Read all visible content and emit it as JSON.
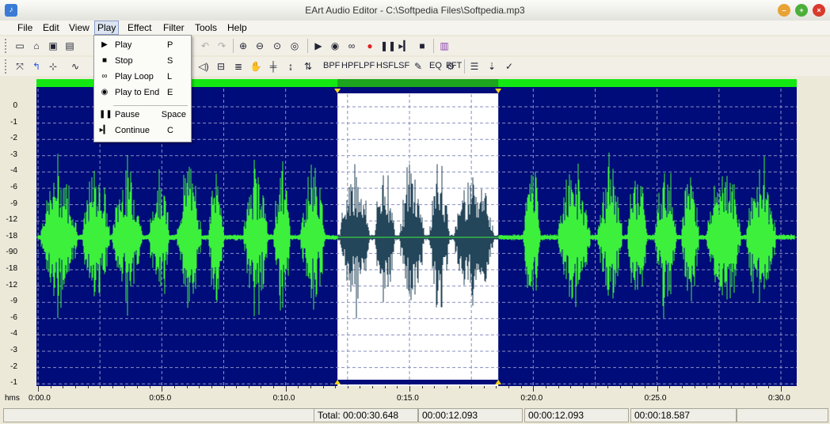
{
  "window": {
    "title": "EArt Audio Editor - C:\\Softpedia Files\\Softpedia.mp3"
  },
  "menu": [
    "File",
    "Edit",
    "View",
    "Play",
    "Effect",
    "Filter",
    "Tools",
    "Help"
  ],
  "play_menu": {
    "items": [
      {
        "icon": "play-icon",
        "label": "Play",
        "shortcut": "P"
      },
      {
        "icon": "stop-icon",
        "label": "Stop",
        "shortcut": "S"
      },
      {
        "icon": "loop-icon",
        "label": "Play Loop",
        "shortcut": "L"
      },
      {
        "icon": "play-to-end-icon",
        "label": "Play to End",
        "shortcut": "E"
      },
      {
        "icon": "pause-icon",
        "label": "Pause",
        "shortcut": "Space"
      },
      {
        "icon": "continue-icon",
        "label": "Continue",
        "shortcut": "C"
      }
    ]
  },
  "filter_buttons": [
    "BPF",
    "HPF",
    "LPF",
    "HSF",
    "LSF",
    "EQ",
    "FFT"
  ],
  "amplitude_ticks": [
    "0",
    "-1",
    "-2",
    "-3",
    "-4",
    "-6",
    "-9",
    "-12",
    "-18",
    "-90",
    "-18",
    "-12",
    "-9",
    "-6",
    "-4",
    "-3",
    "-2",
    "-1",
    "0"
  ],
  "time_axis": {
    "unit_label": "hms",
    "labels": [
      "0:00.0",
      "0:05.0",
      "0:10.0",
      "0:15.0",
      "0:20.0",
      "0:25.0",
      "0:30.0"
    ]
  },
  "selection": {
    "start_s": 12.093,
    "end_s": 18.587
  },
  "status": {
    "total": "Total: 00:00:30.648",
    "start": "00:00:12.093",
    "length": "00:00:12.093",
    "end": "00:00:18.587"
  },
  "colors": {
    "background": "#000c7a",
    "waveform": "#3cf03c",
    "selection_bg": "#ffffff",
    "selection_wave": "#24465a",
    "overview_bar": "#13e813"
  }
}
